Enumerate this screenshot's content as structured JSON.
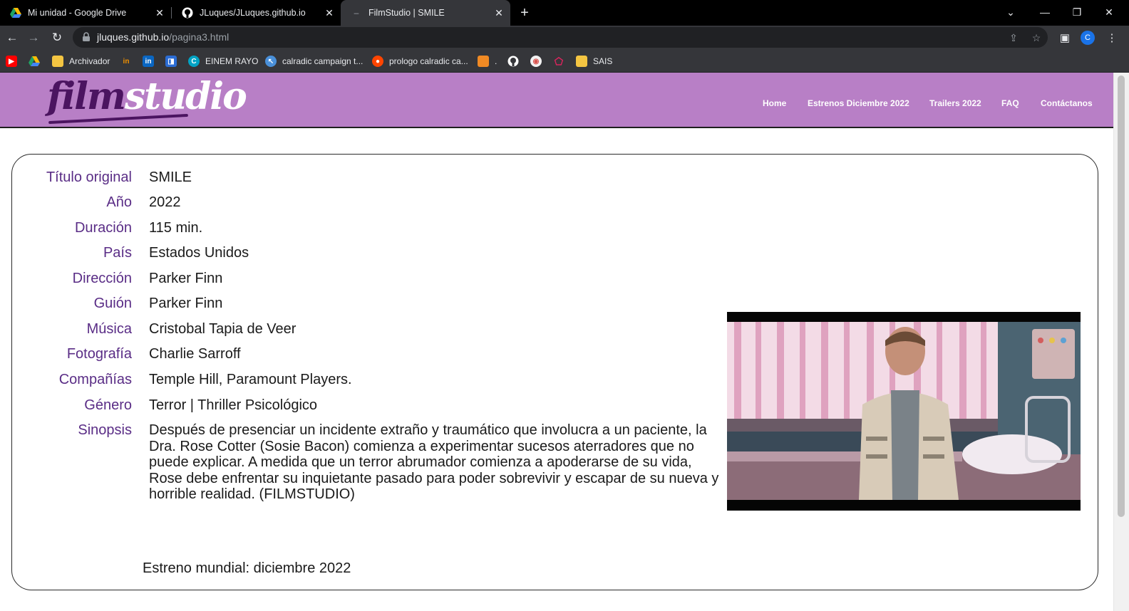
{
  "browser": {
    "tabs": [
      {
        "title": "Mi unidad - Google Drive",
        "active": false
      },
      {
        "title": "JLuques/JLuques.github.io",
        "active": false
      },
      {
        "title": "FilmStudio | SMILE",
        "active": true
      }
    ],
    "url_host": "jluques.github.io",
    "url_path": "/pagina3.html",
    "profile_initial": "C",
    "bookmarks": [
      {
        "label": "",
        "icon": "youtube-icon",
        "color": "#ff0000"
      },
      {
        "label": "",
        "icon": "google-drive-icon",
        "color": "#1fa463"
      },
      {
        "label": "Archivador",
        "icon": "folder-icon",
        "color": "#f4c542"
      },
      {
        "label": "",
        "icon": "infojobs-icon",
        "color": "#f39200"
      },
      {
        "label": "",
        "icon": "linkedin-icon",
        "color": "#0a66c2"
      },
      {
        "label": "",
        "icon": "app-icon",
        "color": "#2b6cd3"
      },
      {
        "label": "EINEM RAYO",
        "icon": "canva-icon",
        "color": "#00c4cc"
      },
      {
        "label": "calradic campaign t...",
        "icon": "site-icon",
        "color": "#4a90d9"
      },
      {
        "label": "prologo calradic ca...",
        "icon": "reddit-icon",
        "color": "#ff4500"
      },
      {
        "label": ".",
        "icon": "box-icon",
        "color": "#f08a24"
      },
      {
        "label": "",
        "icon": "github-icon",
        "color": "#ffffff"
      },
      {
        "label": "",
        "icon": "game-icon",
        "color": "#d9534f"
      },
      {
        "label": "",
        "icon": "gem-icon",
        "color": "#e0245e"
      },
      {
        "label": "SAIS",
        "icon": "folder-icon",
        "color": "#f4c542"
      }
    ]
  },
  "site": {
    "logo_part1": "film",
    "logo_part2": "studio",
    "nav": [
      "Home",
      "Estrenos Diciembre 2022",
      "Trailers 2022",
      "FAQ",
      "Contáctanos"
    ],
    "header_color": "#b87fc6",
    "label_color": "#5a2d86"
  },
  "movie": {
    "rows": [
      {
        "label": "Título original",
        "value": "SMILE"
      },
      {
        "label": "Año",
        "value": "2022"
      },
      {
        "label": "Duración",
        "value": "115 min."
      },
      {
        "label": "País",
        "value": "Estados Unidos"
      },
      {
        "label": "Dirección",
        "value": "Parker Finn"
      },
      {
        "label": "Guión",
        "value": "Parker Finn"
      },
      {
        "label": "Música",
        "value": "Cristobal Tapia de Veer"
      },
      {
        "label": "Fotografía",
        "value": "Charlie Sarroff"
      },
      {
        "label": "Compañías",
        "value": "Temple Hill, Paramount Players."
      },
      {
        "label": "Género",
        "value": "Terror | Thriller Psicológico"
      }
    ],
    "synopsis_label": "Sinopsis",
    "synopsis": "Después de presenciar un incidente extraño y traumático que involucra a un paciente, la Dra. Rose Cotter (Sosie Bacon) comienza a experimentar sucesos aterradores que no puede explicar. A medida que un terror abrumador comienza a apoderarse de su vida, Rose debe enfrentar su inquietante pasado para poder sobrevivir y escapar de su nueva y horrible realidad. (FILMSTUDIO)",
    "release": "Estreno mundial: diciembre 2022"
  }
}
